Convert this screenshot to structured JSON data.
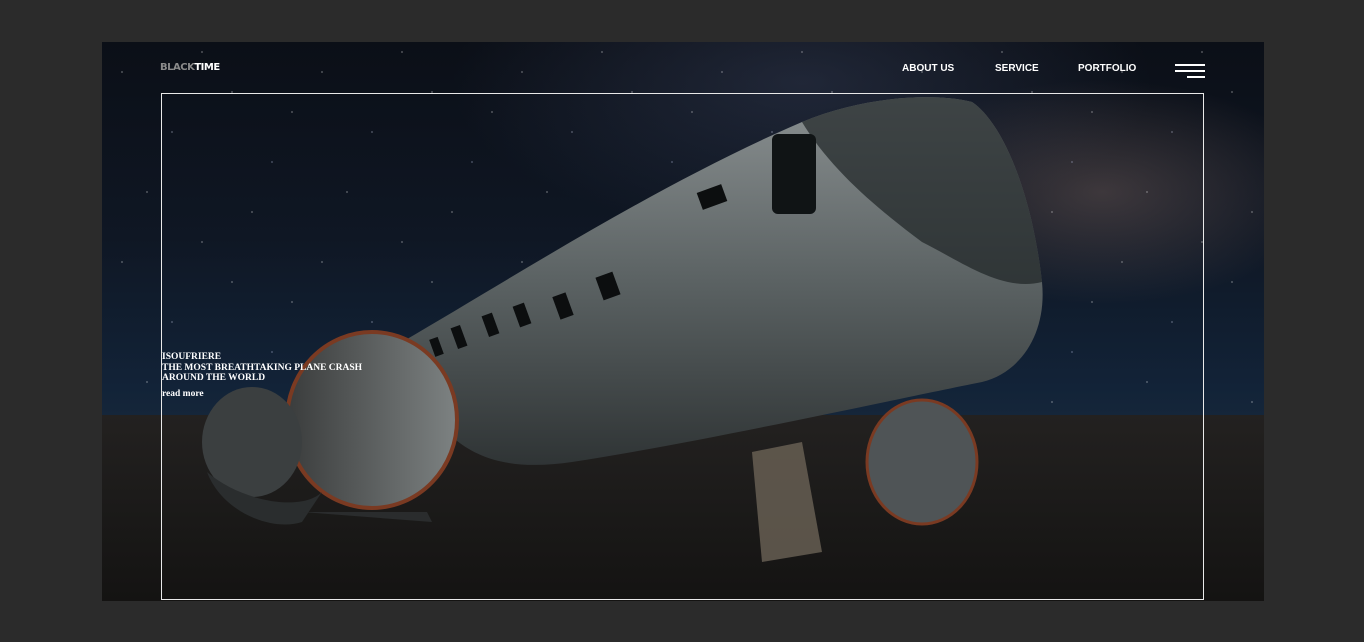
{
  "brand": {
    "part1": "BLACK",
    "part2": "TIME"
  },
  "nav": {
    "items": [
      {
        "label": "ABOUT US"
      },
      {
        "label": "SERVICE"
      },
      {
        "label": "PORTFOLIO"
      }
    ],
    "menu_icon": "hamburger-menu-icon"
  },
  "hero": {
    "kicker": "ISOUFRIERE",
    "headline_line1": "THE MOST BREATHTAKING PLANE CRASH",
    "headline_line2": "AROUND THE WORLD",
    "cta": "read more"
  },
  "colors": {
    "page_background": "#2b2b2b",
    "text": "#ffffff",
    "frame_border": "#e9e9e9",
    "logo_muted": "#8a8a8a"
  }
}
